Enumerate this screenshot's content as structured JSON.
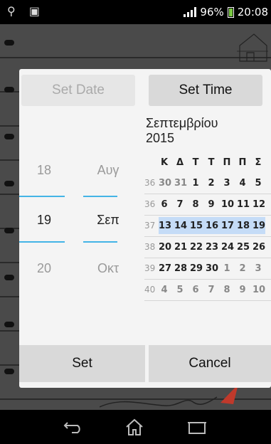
{
  "status": {
    "battery": "96%",
    "time": "20:08",
    "icons": [
      "usb-icon",
      "android-icon",
      "signal-icon",
      "battery-icon"
    ]
  },
  "dialog": {
    "tabs": {
      "date": "Set Date",
      "time": "Set Time"
    },
    "picker": {
      "day_prev": "18",
      "day_sel": "19",
      "day_next": "20",
      "month_prev": "Αυγ",
      "month_sel": "Σεπ",
      "month_next": "Οκτ"
    },
    "calendar": {
      "month": "Σεπτεμβρίου",
      "year": "2015",
      "weekday_headers": [
        "Κ",
        "Δ",
        "Τ",
        "Τ",
        "Π",
        "Π",
        "Σ"
      ],
      "weeks": [
        {
          "num": "36",
          "days": [
            "30",
            "31",
            "1",
            "2",
            "3",
            "4",
            "5"
          ],
          "other": [
            true,
            true,
            false,
            false,
            false,
            false,
            false
          ]
        },
        {
          "num": "36",
          "days": [
            "6",
            "7",
            "8",
            "9",
            "10",
            "11",
            "12"
          ],
          "other": [
            false,
            false,
            false,
            false,
            false,
            false,
            false
          ]
        },
        {
          "num": "37",
          "days": [
            "13",
            "14",
            "15",
            "16",
            "17",
            "18",
            "19"
          ],
          "other": [
            false,
            false,
            false,
            false,
            false,
            false,
            false
          ]
        },
        {
          "num": "38",
          "days": [
            "20",
            "21",
            "22",
            "23",
            "24",
            "25",
            "26"
          ],
          "other": [
            false,
            false,
            false,
            false,
            false,
            false,
            false
          ]
        },
        {
          "num": "39",
          "days": [
            "27",
            "28",
            "29",
            "30",
            "1",
            "2",
            "3"
          ],
          "other": [
            false,
            false,
            false,
            false,
            true,
            true,
            true
          ]
        },
        {
          "num": "40",
          "days": [
            "4",
            "5",
            "6",
            "7",
            "8",
            "9",
            "10"
          ],
          "other": [
            true,
            true,
            true,
            true,
            true,
            true,
            true
          ]
        }
      ],
      "highlight_week": 2,
      "highlight_color": "#c5dcf7"
    },
    "buttons": {
      "set": "Set",
      "cancel": "Cancel"
    },
    "accent": "#43b4e6"
  },
  "nav": {
    "icons": [
      "back-icon",
      "home-icon",
      "recents-icon"
    ]
  }
}
